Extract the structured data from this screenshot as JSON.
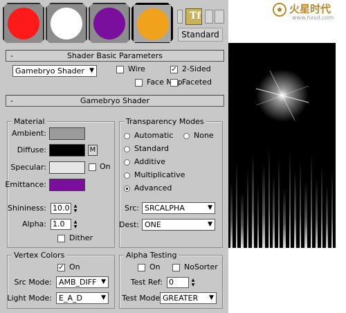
{
  "swatches": [
    {
      "color": "#ff1a1a"
    },
    {
      "color": "#ffffff"
    },
    {
      "color": "#7a0f9e"
    },
    {
      "color": "#f0a21c"
    }
  ],
  "toolbar": {
    "standard_label": "Standard"
  },
  "watermark": {
    "brand": "火星时代",
    "url": "www.hxsd.com"
  },
  "shader_basic": {
    "header": "Shader Basic Parameters",
    "collapse_symbol": "-",
    "shader_dropdown": "Gamebryo Shader",
    "wire": "Wire",
    "two_sided": "2-Sided",
    "face_map": "Face Map",
    "faceted": "Faceted",
    "two_sided_checked": "✓"
  },
  "gamebryo": {
    "header": "Gamebryo Shader",
    "collapse_symbol": "-"
  },
  "material": {
    "title": "Material",
    "ambient_label": "Ambient:",
    "diffuse_label": "Diffuse:",
    "specular_label": "Specular:",
    "emittance_label": "Emittance:",
    "on_label": "On",
    "m_label": "M",
    "ambient_color": "#9b9b9b",
    "diffuse_color": "#000000",
    "specular_color": "#e6e6e6",
    "emittance_color": "#7a0f9e",
    "shininess_label": "Shininess:",
    "shininess_value": "10.0",
    "alpha_label": "Alpha:",
    "alpha_value": "1.0",
    "dither_label": "Dither"
  },
  "transparency": {
    "title": "Transparency Modes",
    "automatic": "Automatic",
    "none": "None",
    "standard": "Standard",
    "additive": "Additive",
    "multiplicative": "Multiplicative",
    "advanced": "Advanced",
    "src_label": "Src:",
    "src_value": "SRCALPHA",
    "dest_label": "Dest:",
    "dest_value": "ONE"
  },
  "vertex_colors": {
    "title": "Vertex Colors",
    "on_label": "On",
    "on_checked": "✓",
    "src_mode_label": "Src Mode:",
    "src_mode_value": "AMB_DIFF",
    "light_mode_label": "Light Mode:",
    "light_mode_value": "E_A_D"
  },
  "alpha_testing": {
    "title": "Alpha Testing",
    "on_label": "On",
    "nosorter_label": "NoSorter",
    "test_ref_label": "Test Ref:",
    "test_ref_value": "0",
    "test_mode_label": "Test Mode:",
    "test_mode_value": "GREATER"
  },
  "icons": {
    "dropdown_arrow": "▼",
    "spin_up": "▲",
    "spin_down": "▼"
  }
}
